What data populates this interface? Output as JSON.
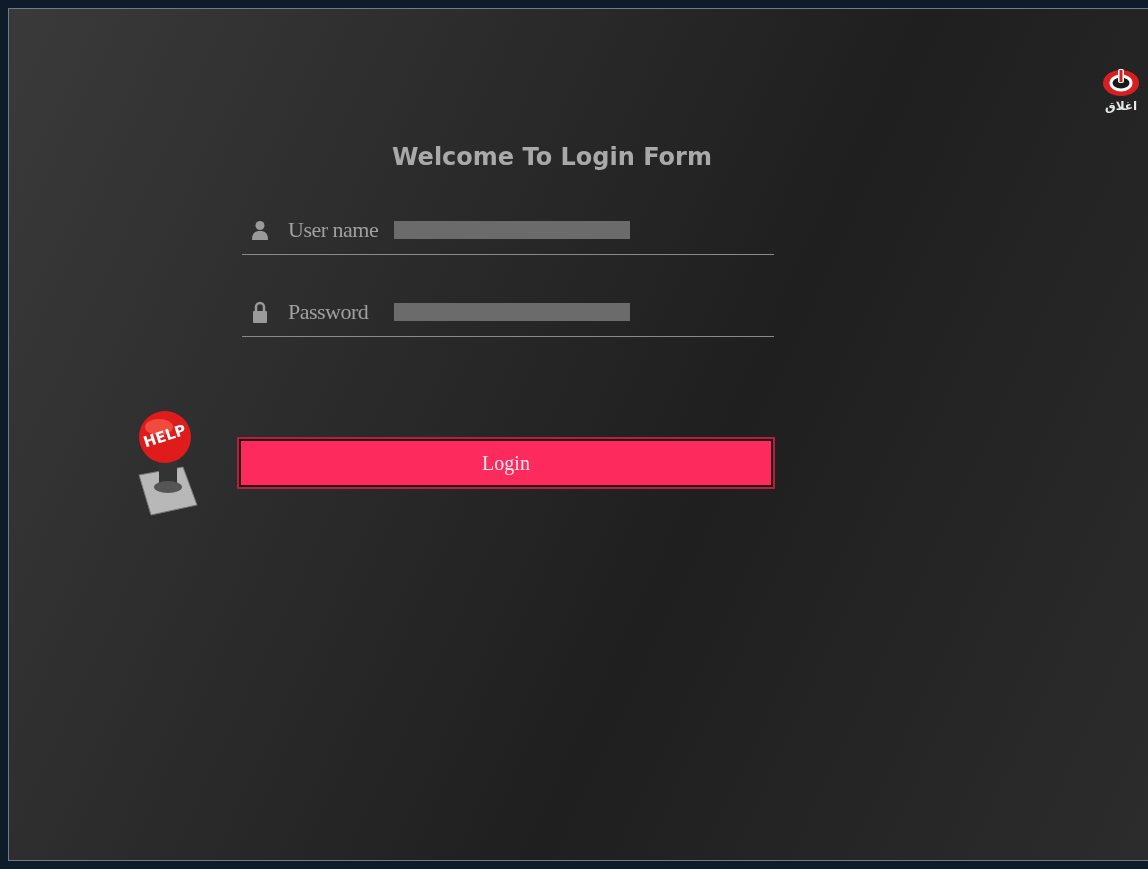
{
  "title": "Welcome To Login Form",
  "close_button": {
    "label": "اغلاق"
  },
  "fields": [
    {
      "kind": "user",
      "label": "User name"
    },
    {
      "kind": "password",
      "label": "Password"
    }
  ],
  "login_button": {
    "label": "Login"
  },
  "help_button": {
    "label": "HELP"
  }
}
